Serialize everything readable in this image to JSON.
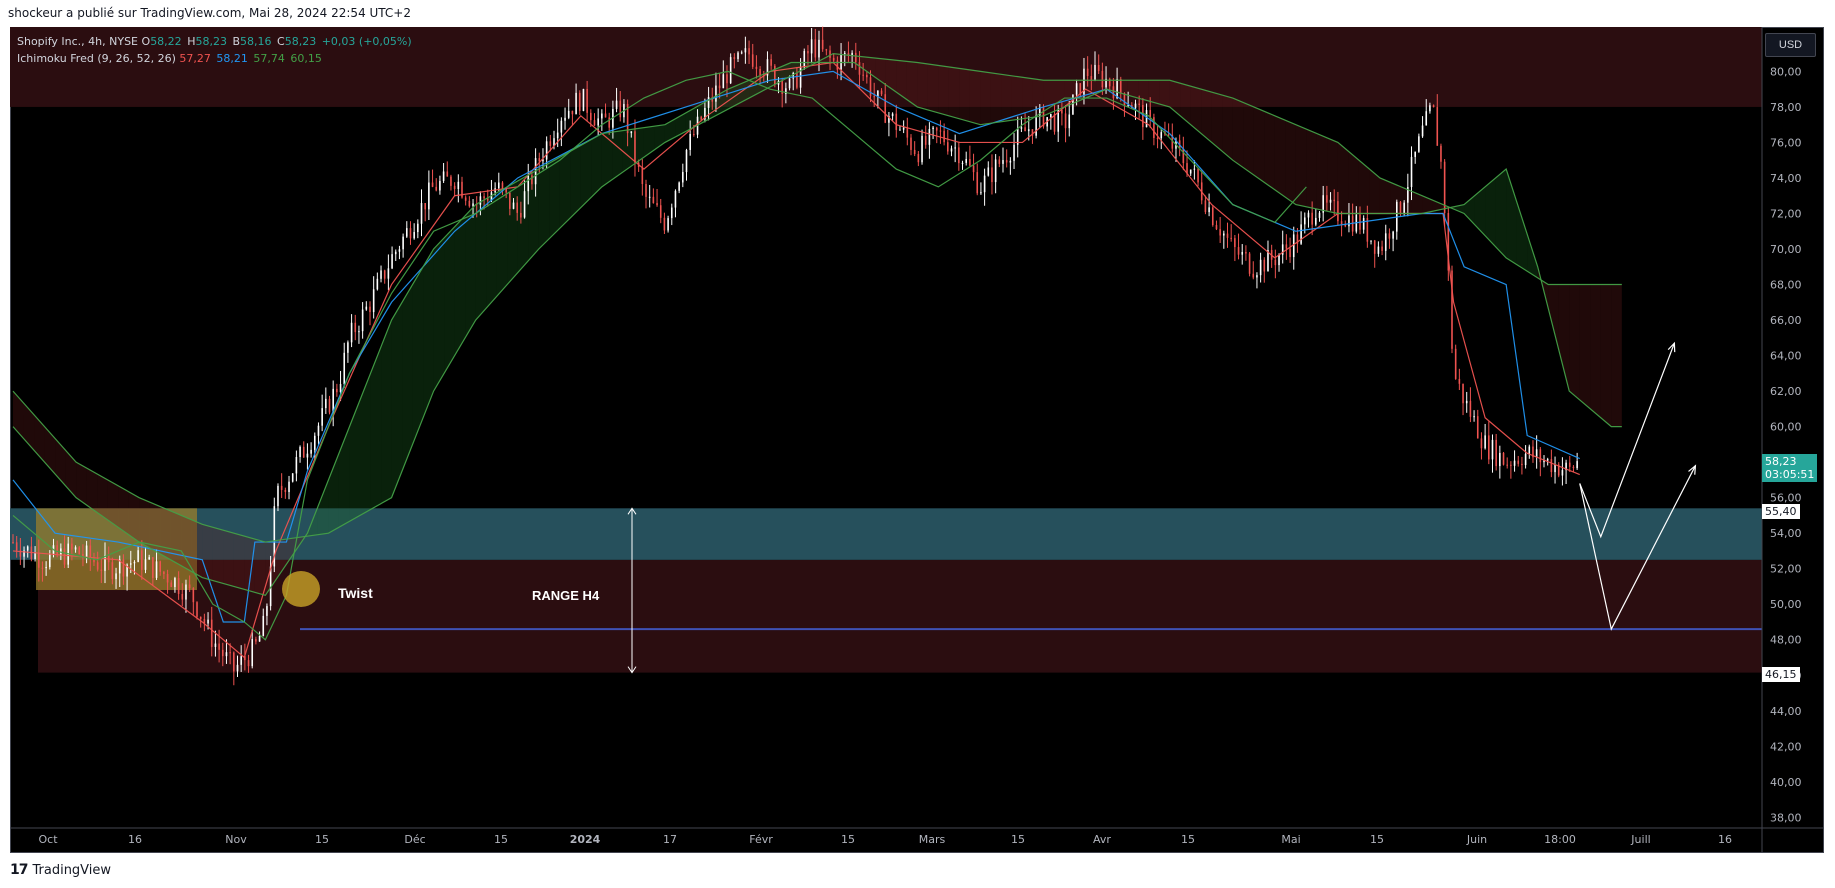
{
  "header": {
    "text": "shockeur a publié sur TradingView.com, Mai 28, 2024 22:54 UTC+2"
  },
  "legend": {
    "line1": {
      "symbol": "Shopify Inc., 4h, NYSE",
      "o_label": "O",
      "o": "58,22",
      "h_label": "H",
      "h": "58,23",
      "b_label": "B",
      "b": "58,16",
      "c_label": "C",
      "c": "58,23",
      "change": "+0,03 (+0,05%)"
    },
    "line2": {
      "name": "Ichimoku Fred (9, 26, 52, 26)",
      "v1": "57,27",
      "v2": "58,21",
      "v3": "57,74",
      "v4": "60,15"
    }
  },
  "currency": "USD",
  "price_tags": {
    "last_price": "58,23",
    "countdown": "03:05:51",
    "level_high": "55,40",
    "level_low": "46,15"
  },
  "annotations": {
    "twist": "Twist",
    "range": "RANGE H4"
  },
  "footer": {
    "logo": "17",
    "brand": "TradingView"
  },
  "colors": {
    "background": "#000000",
    "up": "#ffffff",
    "down": "#ef5350",
    "tenkan": "#ef5350",
    "kijun": "#2196f3",
    "chikou": "#43a047",
    "span_b": "#43a047",
    "zone_blue": "#26505c",
    "zone_red": "#2b0d10",
    "zone_yellow": "#9a7d2b",
    "hline": "#3f51b5"
  },
  "chart_data": {
    "type": "candlestick",
    "title": "Shopify Inc., 4h, NYSE",
    "currency": "USD",
    "x_tick_labels": [
      "Oct",
      "16",
      "Nov",
      "15",
      "Déc",
      "15",
      "2024",
      "17",
      "Févr",
      "15",
      "Mars",
      "15",
      "Avr",
      "15",
      "Mai",
      "15",
      "Juin",
      "18:00",
      "Juill",
      "16"
    ],
    "y_tick_labels": [
      "38,00",
      "40,00",
      "42,00",
      "44,00",
      "46,00",
      "48,00",
      "50,00",
      "52,00",
      "54,00",
      "56,00",
      "58,00",
      "60,00",
      "62,00",
      "64,00",
      "66,00",
      "68,00",
      "70,00",
      "72,00",
      "74,00",
      "76,00",
      "78,00",
      "80,00"
    ],
    "ylim": [
      37.4,
      82.5
    ],
    "price_path": [
      [
        0,
        53.5
      ],
      [
        3,
        52.5
      ],
      [
        6,
        53.0
      ],
      [
        9,
        52.0
      ],
      [
        12,
        52.5
      ],
      [
        15,
        51.5
      ],
      [
        17,
        50.5
      ],
      [
        19,
        48.0
      ],
      [
        21,
        46.3
      ],
      [
        23,
        47.5
      ],
      [
        24,
        49.0
      ],
      [
        25,
        56.0
      ],
      [
        27,
        58.0
      ],
      [
        29,
        60.0
      ],
      [
        31,
        62.5
      ],
      [
        32,
        65.0
      ],
      [
        34,
        67.0
      ],
      [
        36,
        69.5
      ],
      [
        38,
        71.5
      ],
      [
        40,
        73.5
      ],
      [
        42,
        74.0
      ],
      [
        44,
        72.5
      ],
      [
        46,
        73.5
      ],
      [
        48,
        72.0
      ],
      [
        50,
        75.0
      ],
      [
        52,
        77.5
      ],
      [
        54,
        78.5
      ],
      [
        56,
        77.0
      ],
      [
        58,
        78.0
      ],
      [
        60,
        73.0
      ],
      [
        62,
        71.5
      ],
      [
        64,
        75.5
      ],
      [
        66,
        78.0
      ],
      [
        68,
        80.0
      ],
      [
        70,
        81.0
      ],
      [
        72,
        80.0
      ],
      [
        74,
        79.0
      ],
      [
        76,
        81.5
      ],
      [
        78,
        80.5
      ],
      [
        80,
        81.0
      ],
      [
        82,
        78.5
      ],
      [
        84,
        77.0
      ],
      [
        86,
        75.5
      ],
      [
        88,
        76.5
      ],
      [
        90,
        75.5
      ],
      [
        92,
        73.5
      ],
      [
        94,
        75.0
      ],
      [
        96,
        76.5
      ],
      [
        98,
        77.5
      ],
      [
        100,
        77.0
      ],
      [
        102,
        80.0
      ],
      [
        104,
        79.5
      ],
      [
        106,
        78.5
      ],
      [
        108,
        77.0
      ],
      [
        110,
        76.0
      ],
      [
        112,
        74.5
      ],
      [
        114,
        72.0
      ],
      [
        116,
        70.0
      ],
      [
        118,
        69.0
      ],
      [
        120,
        69.5
      ],
      [
        122,
        70.5
      ],
      [
        124,
        72.5
      ],
      [
        126,
        72.0
      ],
      [
        128,
        71.5
      ],
      [
        130,
        70.0
      ],
      [
        132,
        72.5
      ],
      [
        134,
        76.5
      ],
      [
        135,
        78.0
      ],
      [
        136,
        74.0
      ],
      [
        137,
        63.0
      ],
      [
        138,
        61.5
      ],
      [
        140,
        59.0
      ],
      [
        142,
        58.0
      ],
      [
        144,
        58.5
      ],
      [
        146,
        58.0
      ],
      [
        148,
        57.5
      ],
      [
        149,
        58.2
      ]
    ],
    "series": [
      {
        "name": "Tenkan",
        "color": "#ef5350",
        "values": [
          [
            0,
            53.0
          ],
          [
            10,
            52.5
          ],
          [
            18,
            49.0
          ],
          [
            22,
            47.0
          ],
          [
            25,
            53.0
          ],
          [
            30,
            60.0
          ],
          [
            36,
            68.0
          ],
          [
            42,
            73.0
          ],
          [
            48,
            73.5
          ],
          [
            54,
            77.5
          ],
          [
            60,
            74.5
          ],
          [
            66,
            77.5
          ],
          [
            72,
            80.0
          ],
          [
            78,
            80.5
          ],
          [
            84,
            77.0
          ],
          [
            90,
            76.0
          ],
          [
            96,
            76.0
          ],
          [
            102,
            79.0
          ],
          [
            108,
            77.0
          ],
          [
            114,
            72.5
          ],
          [
            120,
            69.5
          ],
          [
            126,
            72.0
          ],
          [
            132,
            72.0
          ],
          [
            136,
            72.0
          ],
          [
            137,
            67.0
          ],
          [
            140,
            60.5
          ],
          [
            144,
            58.5
          ],
          [
            149,
            57.3
          ]
        ]
      },
      {
        "name": "Kijun",
        "color": "#2196f3",
        "values": [
          [
            0,
            57.0
          ],
          [
            4,
            54.0
          ],
          [
            10,
            53.5
          ],
          [
            18,
            52.5
          ],
          [
            20,
            49.0
          ],
          [
            22,
            49.0
          ],
          [
            23,
            53.5
          ],
          [
            26,
            53.5
          ],
          [
            28,
            57.5
          ],
          [
            32,
            63.0
          ],
          [
            36,
            67.0
          ],
          [
            42,
            71.0
          ],
          [
            48,
            74.0
          ],
          [
            56,
            76.5
          ],
          [
            64,
            78.0
          ],
          [
            72,
            79.5
          ],
          [
            78,
            80.0
          ],
          [
            84,
            78.0
          ],
          [
            90,
            76.5
          ],
          [
            98,
            78.0
          ],
          [
            104,
            79.0
          ],
          [
            110,
            76.5
          ],
          [
            116,
            72.5
          ],
          [
            122,
            71.0
          ],
          [
            128,
            71.5
          ],
          [
            134,
            72.0
          ],
          [
            136,
            72.0
          ],
          [
            138,
            69.0
          ],
          [
            142,
            68.0
          ],
          [
            144,
            59.5
          ],
          [
            149,
            58.2
          ]
        ]
      },
      {
        "name": "Span A",
        "color": "#43a047",
        "values": [
          [
            0,
            60.0
          ],
          [
            6,
            56.0
          ],
          [
            12,
            53.5
          ],
          [
            18,
            51.5
          ],
          [
            24,
            50.5
          ],
          [
            28,
            54.0
          ],
          [
            32,
            60.0
          ],
          [
            36,
            66.0
          ],
          [
            40,
            70.0
          ],
          [
            44,
            72.5
          ],
          [
            50,
            74.5
          ],
          [
            56,
            76.5
          ],
          [
            62,
            77.0
          ],
          [
            68,
            79.0
          ],
          [
            74,
            80.5
          ],
          [
            80,
            80.5
          ],
          [
            86,
            78.0
          ],
          [
            92,
            77.0
          ],
          [
            98,
            77.5
          ],
          [
            104,
            79.0
          ],
          [
            110,
            78.0
          ],
          [
            116,
            75.0
          ],
          [
            122,
            72.5
          ],
          [
            126,
            72.0
          ],
          [
            130,
            72.0
          ],
          [
            134,
            72.0
          ],
          [
            138,
            72.5
          ],
          [
            142,
            74.5
          ],
          [
            145,
            69.0
          ],
          [
            148,
            62.0
          ],
          [
            152,
            60.0
          ],
          [
            153,
            60.0
          ]
        ]
      },
      {
        "name": "Span B",
        "color": "#43a047",
        "values": [
          [
            0,
            62.0
          ],
          [
            6,
            58.0
          ],
          [
            12,
            56.0
          ],
          [
            18,
            54.5
          ],
          [
            24,
            53.5
          ],
          [
            30,
            54.0
          ],
          [
            36,
            56.0
          ],
          [
            40,
            62.0
          ],
          [
            44,
            66.0
          ],
          [
            50,
            70.0
          ],
          [
            56,
            73.5
          ],
          [
            62,
            76.0
          ],
          [
            70,
            78.5
          ],
          [
            78,
            81.0
          ],
          [
            86,
            80.5
          ],
          [
            92,
            80.0
          ],
          [
            98,
            79.5
          ],
          [
            104,
            79.5
          ],
          [
            110,
            79.5
          ],
          [
            116,
            78.5
          ],
          [
            120,
            77.5
          ],
          [
            126,
            76.0
          ],
          [
            130,
            74.0
          ],
          [
            134,
            73.0
          ],
          [
            138,
            72.0
          ],
          [
            142,
            69.5
          ],
          [
            146,
            68.0
          ],
          [
            148,
            68.0
          ],
          [
            152,
            68.0
          ],
          [
            153,
            68.0
          ]
        ]
      },
      {
        "name": "Chikou",
        "color": "#43a047",
        "values": [
          [
            0,
            55.0
          ],
          [
            4,
            53.0
          ],
          [
            8,
            52.5
          ],
          [
            12,
            53.5
          ],
          [
            16,
            53.0
          ],
          [
            19,
            50.0
          ],
          [
            22,
            49.0
          ],
          [
            24,
            48.0
          ],
          [
            26,
            50.5
          ],
          [
            28,
            57.0
          ],
          [
            32,
            63.0
          ],
          [
            36,
            67.5
          ],
          [
            40,
            71.0
          ],
          [
            44,
            72.0
          ],
          [
            48,
            73.5
          ],
          [
            52,
            75.0
          ],
          [
            56,
            77.0
          ],
          [
            60,
            78.5
          ],
          [
            64,
            79.5
          ],
          [
            68,
            80.0
          ],
          [
            72,
            79.0
          ],
          [
            76,
            78.5
          ],
          [
            80,
            76.5
          ],
          [
            84,
            74.5
          ],
          [
            88,
            73.5
          ],
          [
            92,
            75.0
          ],
          [
            96,
            77.0
          ],
          [
            100,
            78.5
          ],
          [
            104,
            78.5
          ],
          [
            108,
            77.5
          ],
          [
            112,
            75.0
          ],
          [
            116,
            72.5
          ],
          [
            120,
            71.5
          ],
          [
            123,
            73.5
          ]
        ]
      }
    ],
    "zones": [
      {
        "name": "supply zone",
        "from": 78.0,
        "to": 82.5,
        "color": "#2b0d10"
      },
      {
        "name": "range zone",
        "from": 46.15,
        "to": 52.5,
        "color": "#2b0d10"
      },
      {
        "name": "blue zone",
        "from": 52.5,
        "to": 55.4,
        "color": "#26505c"
      },
      {
        "name": "yellow box",
        "from": 50.8,
        "to": 55.4,
        "color": "#9a7d2b"
      }
    ],
    "horizontal_line": 48.6,
    "scenario_paths": [
      [
        [
          149,
          56.8
        ],
        [
          151,
          53.8
        ],
        [
          158,
          64.7
        ]
      ],
      [
        [
          149,
          56.8
        ],
        [
          152,
          48.6
        ],
        [
          160,
          57.8
        ]
      ]
    ],
    "last_price": 58.23,
    "levels": [
      55.4,
      46.15
    ]
  }
}
